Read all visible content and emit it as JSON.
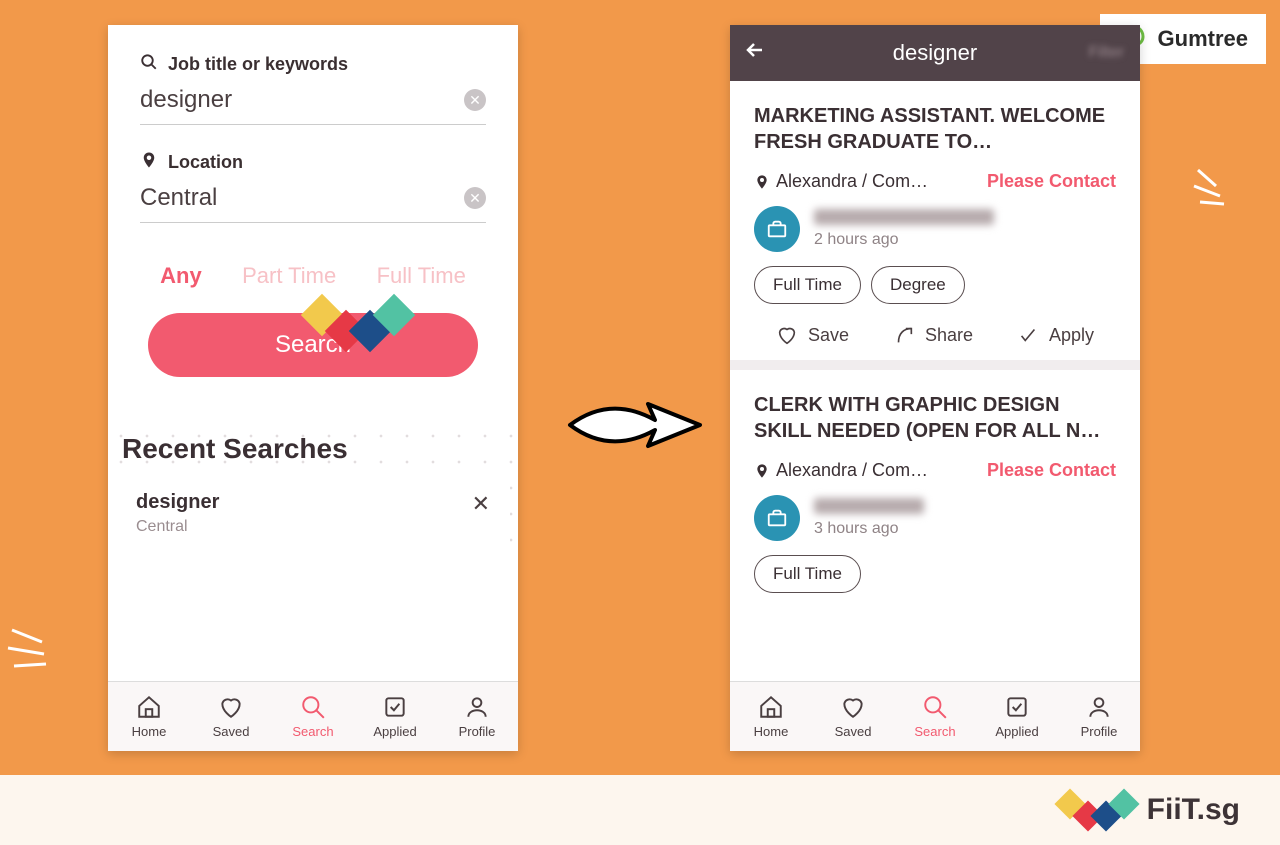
{
  "badge": {
    "label": "Gumtree"
  },
  "footer": {
    "brand": "FiiT.sg"
  },
  "left_phone": {
    "search_label": "Job title or keywords",
    "search_value": "designer",
    "location_label": "Location",
    "location_value": "Central",
    "job_types": {
      "any": "Any",
      "part": "Part Time",
      "full": "Full Time"
    },
    "search_button": "Search",
    "recent_header": "Recent Searches",
    "recent_item": {
      "term": "designer",
      "location": "Central"
    }
  },
  "right_phone": {
    "header_title": "designer",
    "jobs": [
      {
        "title": "MARKETING ASSISTANT. WELCOME FRESH GRADUATE TO…",
        "location": "Alexandra / Com…",
        "contact": "Please Contact",
        "time": "2 hours ago",
        "pills": [
          "Full Time",
          "Degree"
        ]
      },
      {
        "title": "CLERK WITH GRAPHIC DESIGN SKILL NEEDED (OPEN FOR ALL N…",
        "location": "Alexandra / Com…",
        "contact": "Please Contact",
        "time": "3 hours ago",
        "pills": [
          "Full Time"
        ]
      }
    ],
    "actions": {
      "save": "Save",
      "share": "Share",
      "apply": "Apply"
    }
  },
  "tabs": {
    "home": "Home",
    "saved": "Saved",
    "search": "Search",
    "applied": "Applied",
    "profile": "Profile"
  }
}
